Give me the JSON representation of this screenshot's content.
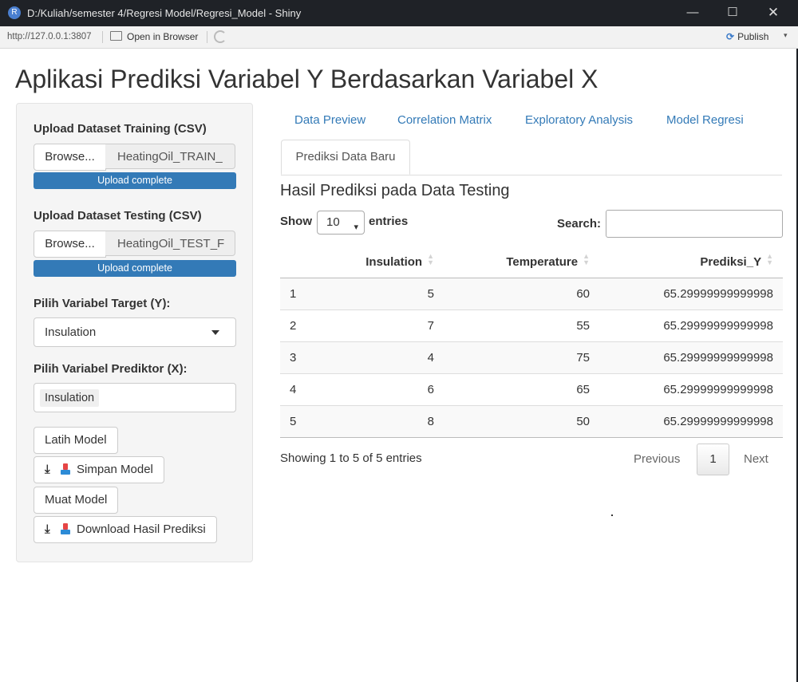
{
  "window": {
    "title": "D:/Kuliah/semester 4/Regresi Model/Regresi_Model - Shiny",
    "app_icon": "R",
    "minimize": "—",
    "maximize": "☐",
    "close": "✕"
  },
  "toolbar": {
    "url": "http://127.0.0.1:3807",
    "open_in_browser": "Open in Browser",
    "publish": "Publish",
    "publish_caret": "▾"
  },
  "app": {
    "title": "Aplikasi Prediksi Variabel Y Berdasarkan Variabel X"
  },
  "sidebar": {
    "train_label": "Upload Dataset Training (CSV)",
    "train_browse": "Browse...",
    "train_file": "HeatingOil_TRAIN_",
    "train_progress": "Upload complete",
    "test_label": "Upload Dataset Testing (CSV)",
    "test_browse": "Browse...",
    "test_file": "HeatingOil_TEST_F",
    "test_progress": "Upload complete",
    "target_label": "Pilih Variabel Target (Y):",
    "target_value": "Insulation",
    "predictor_label": "Pilih Variabel Prediktor (X):",
    "predictor_chip": "Insulation",
    "btn_latih": "Latih Model",
    "btn_simpan": "Simpan Model",
    "btn_muat": "Muat Model",
    "btn_download": "Download Hasil Prediksi",
    "download_glyph": "⤓"
  },
  "tabs": {
    "items": [
      "Data Preview",
      "Correlation Matrix",
      "Exploratory Analysis",
      "Model Regresi"
    ],
    "active": "Prediksi Data Baru"
  },
  "main": {
    "section_title": "Hasil Prediksi pada Data Testing",
    "show": "Show",
    "page_length": "10",
    "entries": "entries",
    "search_label": "Search:",
    "search_value": "",
    "columns": [
      "",
      "Insulation",
      "Temperature",
      "Prediksi_Y"
    ],
    "rows": [
      [
        "1",
        "5",
        "60",
        "65.29999999999998"
      ],
      [
        "2",
        "7",
        "55",
        "65.29999999999998"
      ],
      [
        "3",
        "4",
        "75",
        "65.29999999999998"
      ],
      [
        "4",
        "6",
        "65",
        "65.29999999999998"
      ],
      [
        "5",
        "8",
        "50",
        "65.29999999999998"
      ]
    ],
    "info": "Showing 1 to 5 of 5 entries",
    "prev": "Previous",
    "page": "1",
    "next": "Next"
  }
}
